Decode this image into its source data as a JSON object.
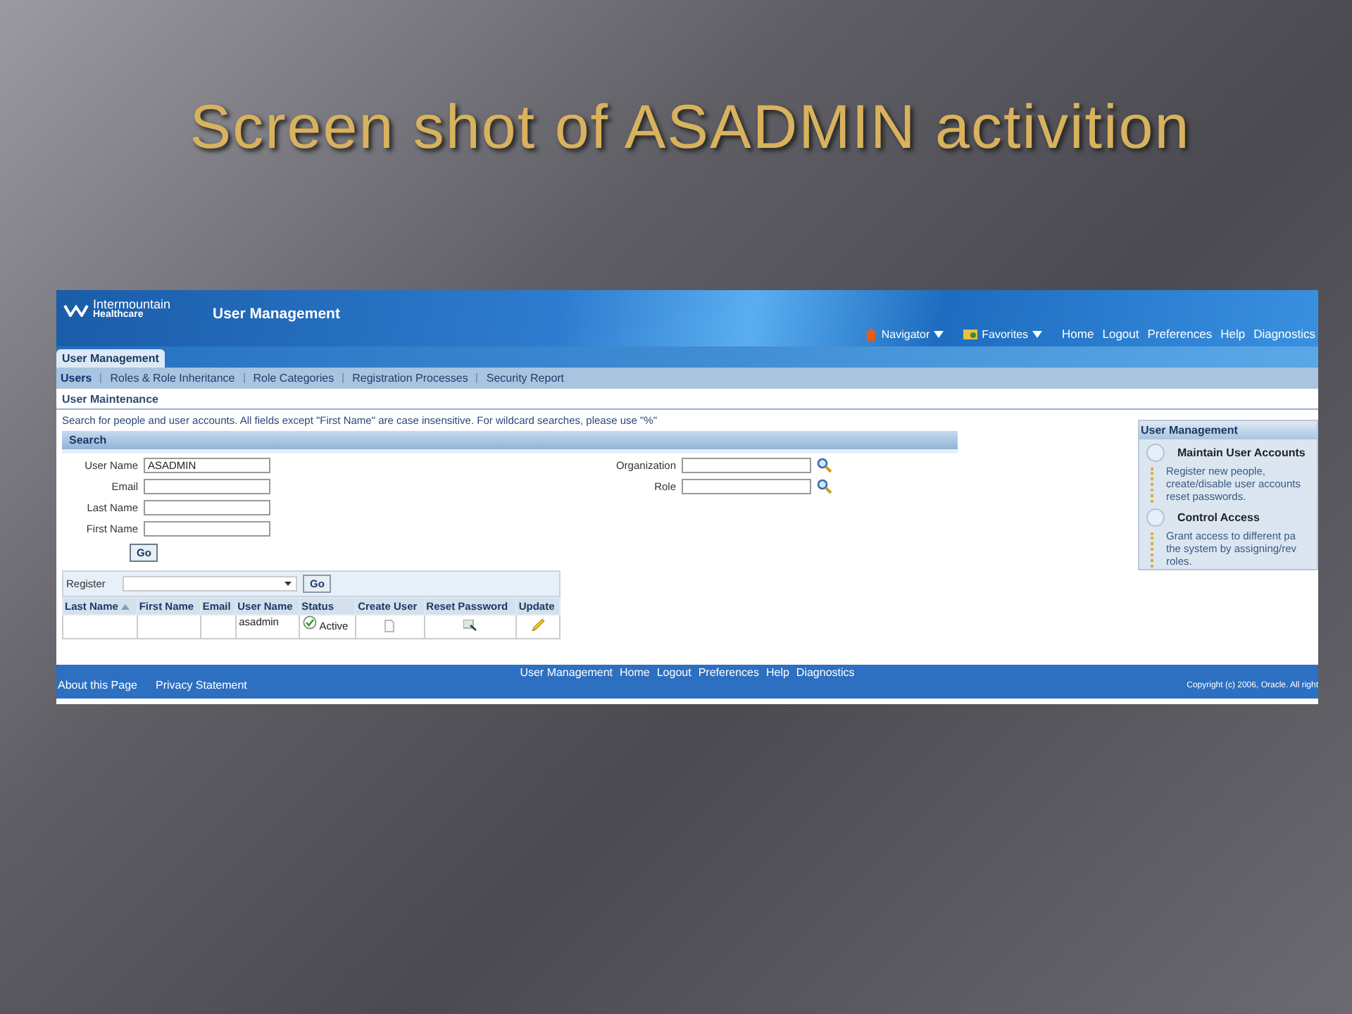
{
  "slide_title": "Screen shot of ASADMIN activition",
  "app": {
    "logo_line1": "Intermountain",
    "logo_line2": "Healthcare",
    "title": "User Management",
    "global_menus": [
      "Navigator",
      "Favorites"
    ],
    "global_links": [
      "Home",
      "Logout",
      "Preferences",
      "Help",
      "Diagnostics"
    ],
    "tabs": [
      {
        "label": "User Management",
        "selected": true
      }
    ],
    "subtabs": [
      {
        "label": "Users",
        "selected": true
      },
      {
        "label": "Roles & Role Inheritance",
        "selected": false
      },
      {
        "label": "Role Categories",
        "selected": false
      },
      {
        "label": "Registration Processes",
        "selected": false
      },
      {
        "label": "Security Report",
        "selected": false
      }
    ],
    "page_title": "User Maintenance",
    "instructions": "Search for people and user accounts. All fields except \"First Name\" are case insensitive. For wildcard searches, please use \"%\"",
    "search": {
      "header": "Search",
      "left_fields": [
        {
          "label": "User Name",
          "value": "ASADMIN"
        },
        {
          "label": "Email"
        },
        {
          "label": "Last Name"
        },
        {
          "label": "First Name"
        }
      ],
      "right_fields": [
        {
          "label": "Organization"
        },
        {
          "label": "Role"
        }
      ],
      "go": "Go"
    },
    "results": {
      "action_label": "Register",
      "go": "Go",
      "columns": [
        {
          "label": "Last Name",
          "sorted": true
        },
        {
          "label": "First Name",
          "sorted": false
        },
        {
          "label": "Email",
          "sorted": false
        },
        {
          "label": "User Name",
          "sorted": false
        },
        {
          "label": "Status",
          "sorted": false
        },
        {
          "label": "Create User",
          "sorted": false
        },
        {
          "label": "Reset Password",
          "sorted": false
        },
        {
          "label": "Update",
          "sorted": false
        }
      ],
      "rows": [
        {
          "user_name": "asadmin",
          "status": "Active"
        }
      ]
    },
    "side_panel": {
      "header": "User Management",
      "items": [
        {
          "title": "Maintain User Accounts",
          "text": "Register new people,\ncreate/disable user accounts\nreset passwords."
        },
        {
          "title": "Control Access",
          "text": "Grant access to different pa\nthe system by assigning/rev\nroles."
        }
      ]
    },
    "footer": {
      "links": [
        "User Management",
        "Home",
        "Logout",
        "Preferences",
        "Help",
        "Diagnostics"
      ],
      "left_links": [
        "About this Page",
        "Privacy Statement"
      ],
      "copyright": "Copyright (c) 2006, Oracle. All right"
    }
  }
}
